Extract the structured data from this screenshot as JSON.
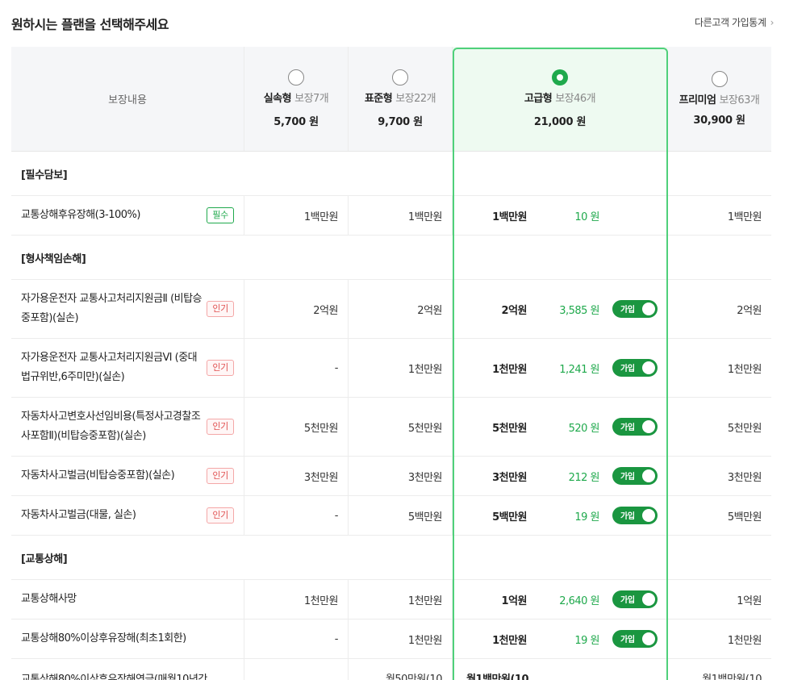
{
  "header": {
    "title": "원하시는 플랜을 선택해주세요",
    "stats_link": "다른고객 가입통계"
  },
  "table_head": {
    "coverage_label": "보장내용"
  },
  "plans": [
    {
      "name": "실속형",
      "count": "보장7개",
      "price": "5,700 원",
      "selected": false
    },
    {
      "name": "표준형",
      "count": "보장22개",
      "price": "9,700 원",
      "selected": false
    },
    {
      "name": "고급형",
      "count": "보장46개",
      "price": "21,000 원",
      "selected": true
    },
    {
      "name": "프리미엄",
      "count": "보장63개",
      "price": "30,900 원",
      "selected": false
    }
  ],
  "toggle_label": "가입",
  "sections": [
    {
      "title": "[필수담보]",
      "items": [
        {
          "label": "교통상해후유장해(3-100%)",
          "badge": "필수",
          "v1": "1백만원",
          "v2": "1백만원",
          "v3": "1백만원",
          "fee": "10 원",
          "toggle": false,
          "v4": "1백만원"
        }
      ]
    },
    {
      "title": "[형사책임손해]",
      "items": [
        {
          "label": "자가용운전자 교통사고처리지원금Ⅱ (비탑승중포함)(실손)",
          "badge": "인기",
          "v1": "2억원",
          "v2": "2억원",
          "v3": "2억원",
          "fee": "3,585 원",
          "toggle": true,
          "v4": "2억원"
        },
        {
          "label": "자가용운전자 교통사고처리지원금Ⅵ (중대법규위반,6주미만)(실손)",
          "badge": "인기",
          "v1": "-",
          "v2": "1천만원",
          "v3": "1천만원",
          "fee": "1,241 원",
          "toggle": true,
          "v4": "1천만원"
        },
        {
          "label": "자동차사고변호사선임비용(특정사고경찰조사포함Ⅱ)(비탑승중포함)(실손)",
          "badge": "인기",
          "v1": "5천만원",
          "v2": "5천만원",
          "v3": "5천만원",
          "fee": "520 원",
          "toggle": true,
          "v4": "5천만원"
        },
        {
          "label": "자동차사고벌금(비탑승중포함)(실손)",
          "badge": "인기",
          "v1": "3천만원",
          "v2": "3천만원",
          "v3": "3천만원",
          "fee": "212 원",
          "toggle": true,
          "v4": "3천만원"
        },
        {
          "label": "자동차사고벌금(대물, 실손)",
          "badge": "인기",
          "v1": "-",
          "v2": "5백만원",
          "v3": "5백만원",
          "fee": "19 원",
          "toggle": true,
          "v4": "5백만원"
        }
      ]
    },
    {
      "title": "[교통상해]",
      "items": [
        {
          "label": "교통상해사망",
          "badge": "",
          "v1": "1천만원",
          "v2": "1천만원",
          "v3": "1억원",
          "fee": "2,640 원",
          "toggle": true,
          "v4": "1억원"
        },
        {
          "label": "교통상해80%이상후유장해(최초1회한)",
          "badge": "",
          "v1": "-",
          "v2": "1천만원",
          "v3": "1천만원",
          "fee": "19 원",
          "toggle": true,
          "v4": "1천만원"
        }
      ]
    }
  ],
  "cut_row": {
    "label": "교통상해80%이상후유장해연금(매월10년간",
    "v2": "월50만원(10",
    "v3": "월1백만원(10",
    "v4": "월1백만원(10"
  }
}
